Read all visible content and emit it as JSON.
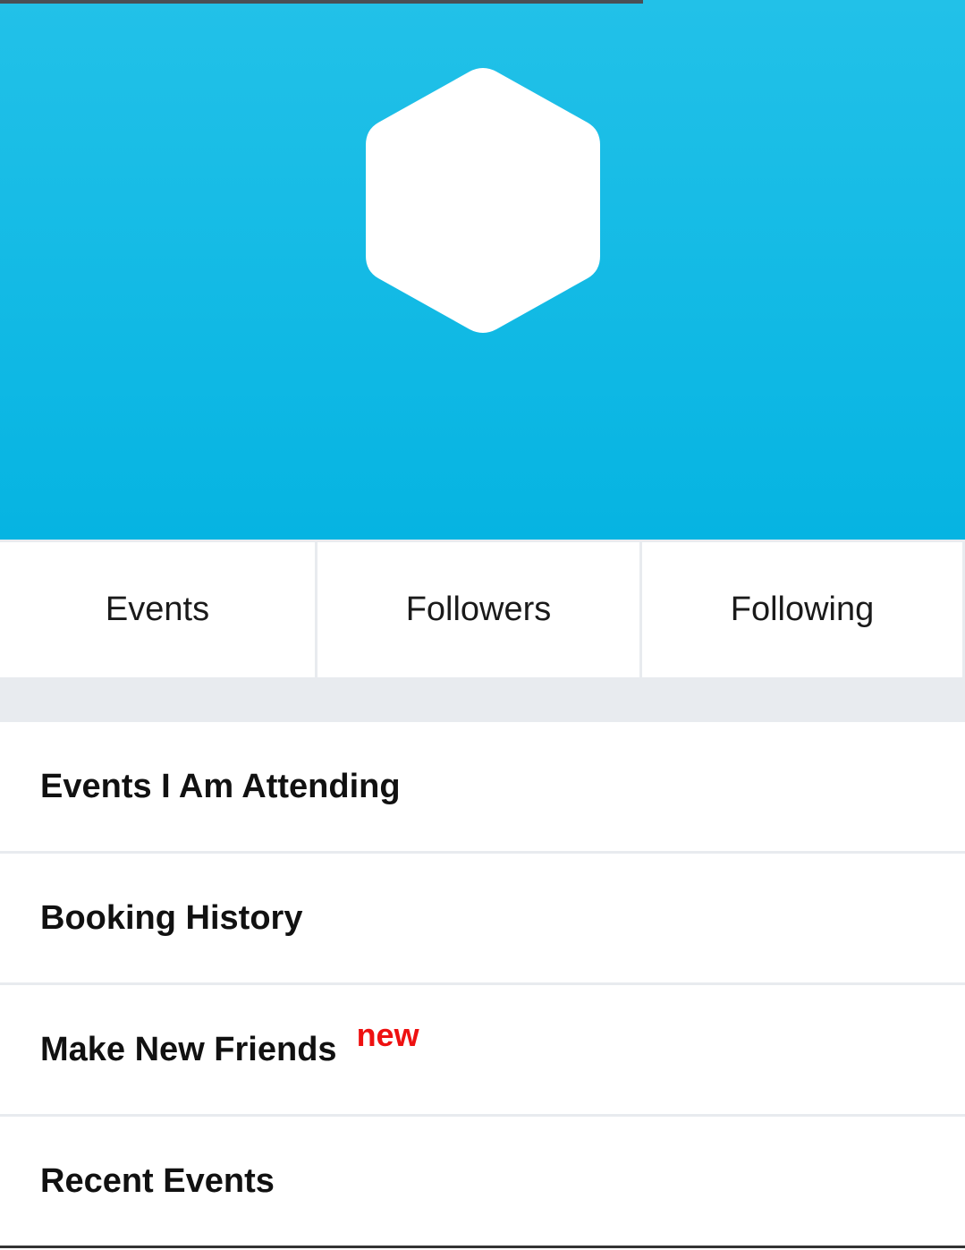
{
  "progress": {
    "fraction": 0.666,
    "color": "#4a4f55"
  },
  "header": {
    "background_top": "#22c1e8",
    "background_bottom": "#06b4e2",
    "avatar_icon": "hexagon-avatar-icon"
  },
  "stats": {
    "events_label": "Events",
    "followers_label": "Followers",
    "following_label": "Following"
  },
  "menu": {
    "items": [
      {
        "label": "Events I Am Attending"
      },
      {
        "label": "Booking History"
      },
      {
        "label": "Make New Friends",
        "badge": "new"
      },
      {
        "label": "Recent Events"
      }
    ]
  },
  "colors": {
    "badge": "#ee1111",
    "divider": "#e8ebef"
  }
}
